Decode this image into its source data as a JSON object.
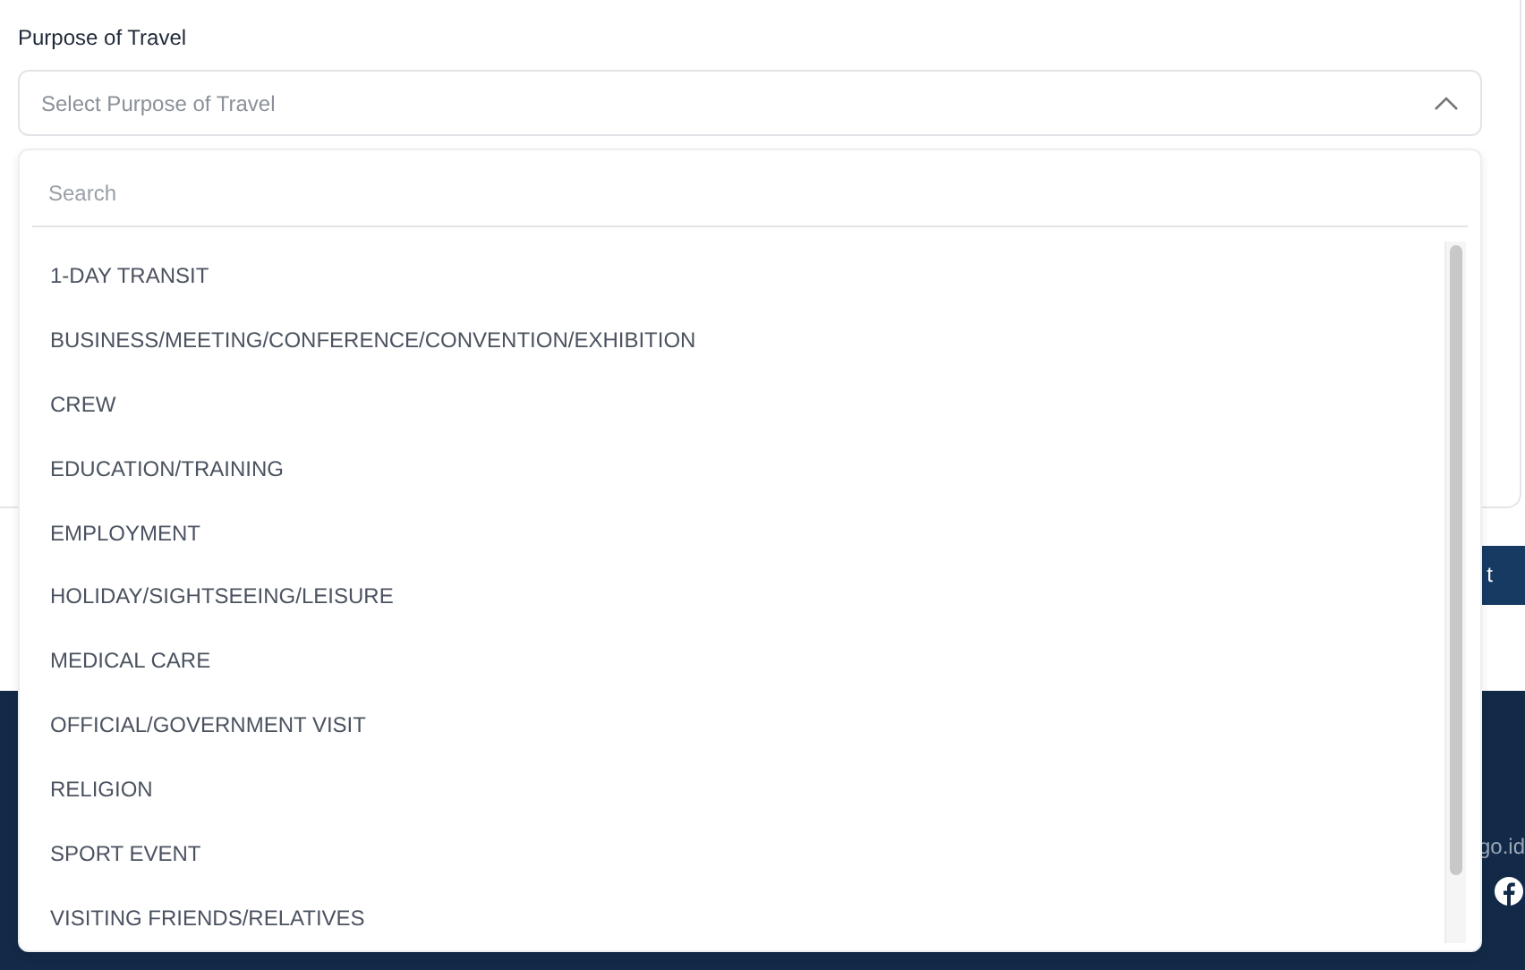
{
  "form": {
    "label": "Purpose of Travel",
    "select": {
      "placeholder": "Select Purpose of Travel",
      "expanded": true
    },
    "dropdown": {
      "search_placeholder": "Search",
      "options": [
        {
          "label": "1-DAY TRANSIT"
        },
        {
          "label": "BUSINESS/MEETING/CONFERENCE/CONVENTION/EXHIBITION"
        },
        {
          "label": "CREW"
        },
        {
          "label": "EDUCATION/TRAINING"
        },
        {
          "label": "EMPLOYMENT"
        },
        {
          "label": "HOLIDAY/SIGHTSEEING/LEISURE"
        },
        {
          "label": "MEDICAL CARE"
        },
        {
          "label": "OFFICIAL/GOVERNMENT VISIT"
        },
        {
          "label": "RELIGION"
        },
        {
          "label": "SPORT EVENT"
        },
        {
          "label": "VISITING FRIENDS/RELATIVES"
        }
      ]
    }
  },
  "button": {
    "label": "t"
  },
  "footer": {
    "text": "go.id"
  }
}
